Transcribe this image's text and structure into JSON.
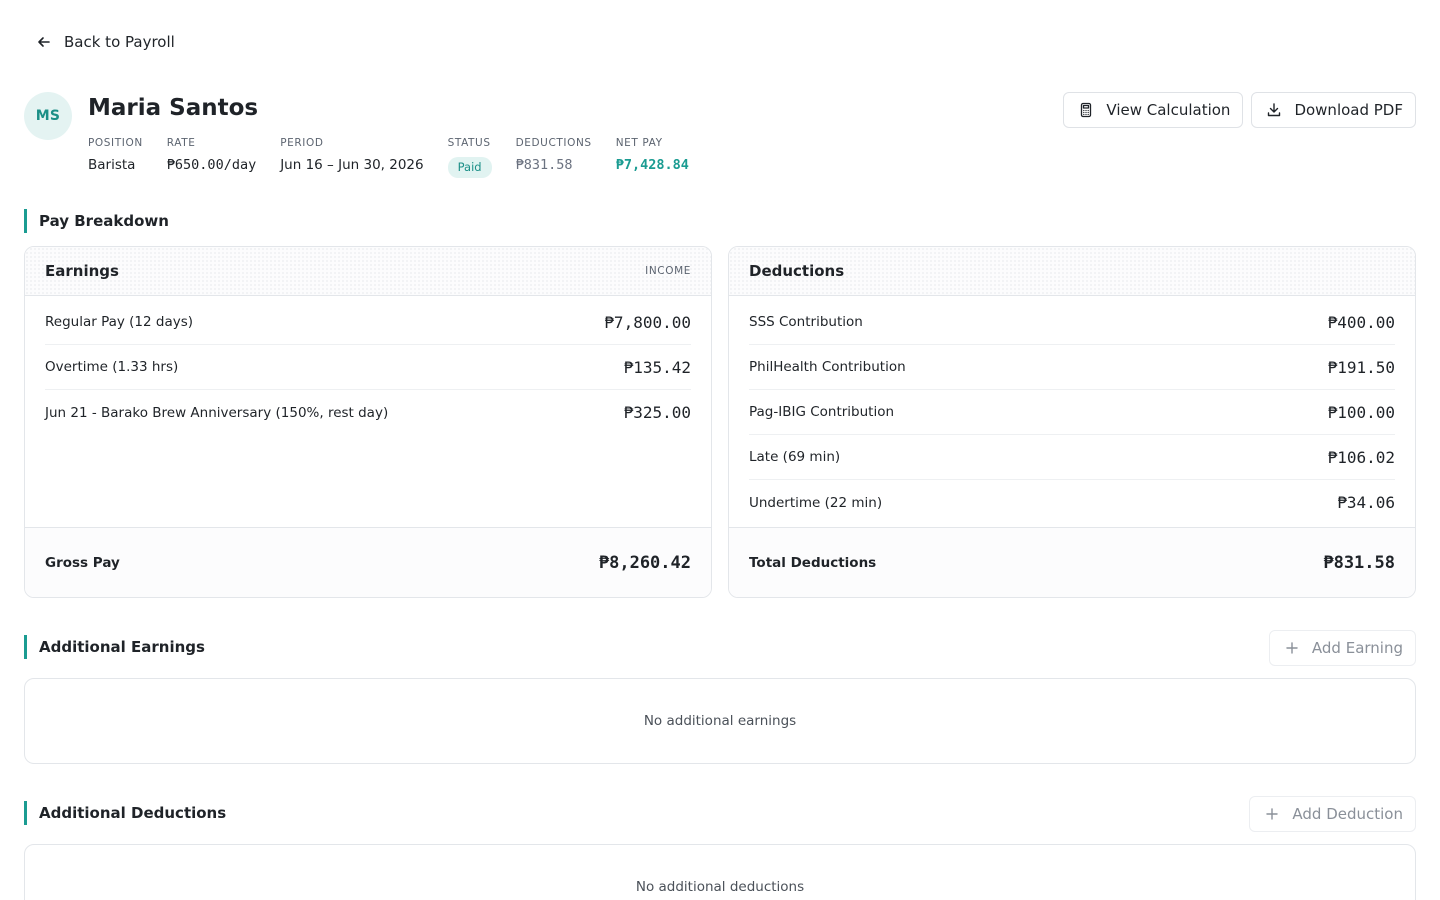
{
  "nav": {
    "back_label": "Back to Payroll"
  },
  "employee": {
    "initials": "MS",
    "name": "Maria Santos"
  },
  "meta": {
    "position_label": "POSITION",
    "position_value": "Barista",
    "rate_label": "RATE",
    "rate_value": "₱650.00/day",
    "period_label": "PERIOD",
    "period_value": "Jun 16 – Jun 30, 2026",
    "status_label": "STATUS",
    "status_value": "Paid",
    "deductions_label": "DEDUCTIONS",
    "deductions_value": "₱831.58",
    "net_pay_label": "NET PAY",
    "net_pay_value": "₱7,428.84"
  },
  "actions": {
    "view_calculation": "View Calculation",
    "download_pdf": "Download PDF"
  },
  "pay_breakdown": {
    "title": "Pay Breakdown",
    "earnings": {
      "title": "Earnings",
      "tag": "INCOME",
      "rows": [
        {
          "label": "Regular Pay (12 days)",
          "amount": "₱7,800.00"
        },
        {
          "label": "Overtime (1.33 hrs)",
          "amount": "₱135.42"
        },
        {
          "label": "Jun 21 - Barako Brew Anniversary (150%, rest day)",
          "amount": "₱325.00"
        }
      ],
      "total_label": "Gross Pay",
      "total_amount": "₱8,260.42"
    },
    "deductions": {
      "title": "Deductions",
      "rows": [
        {
          "label": "SSS Contribution",
          "amount": "₱400.00"
        },
        {
          "label": "PhilHealth Contribution",
          "amount": "₱191.50"
        },
        {
          "label": "Pag-IBIG Contribution",
          "amount": "₱100.00"
        },
        {
          "label": "Late (69 min)",
          "amount": "₱106.02"
        },
        {
          "label": "Undertime (22 min)",
          "amount": "₱34.06"
        }
      ],
      "total_label": "Total Deductions",
      "total_amount": "₱831.58"
    }
  },
  "additional_earnings": {
    "title": "Additional Earnings",
    "add_label": "Add Earning",
    "empty_text": "No additional earnings"
  },
  "additional_deductions": {
    "title": "Additional Deductions",
    "add_label": "Add Deduction",
    "empty_text": "No additional deductions"
  },
  "colors": {
    "accent": "#1b9c92",
    "badge_bg": "#e1f3f1",
    "border": "#e3e6ea"
  }
}
